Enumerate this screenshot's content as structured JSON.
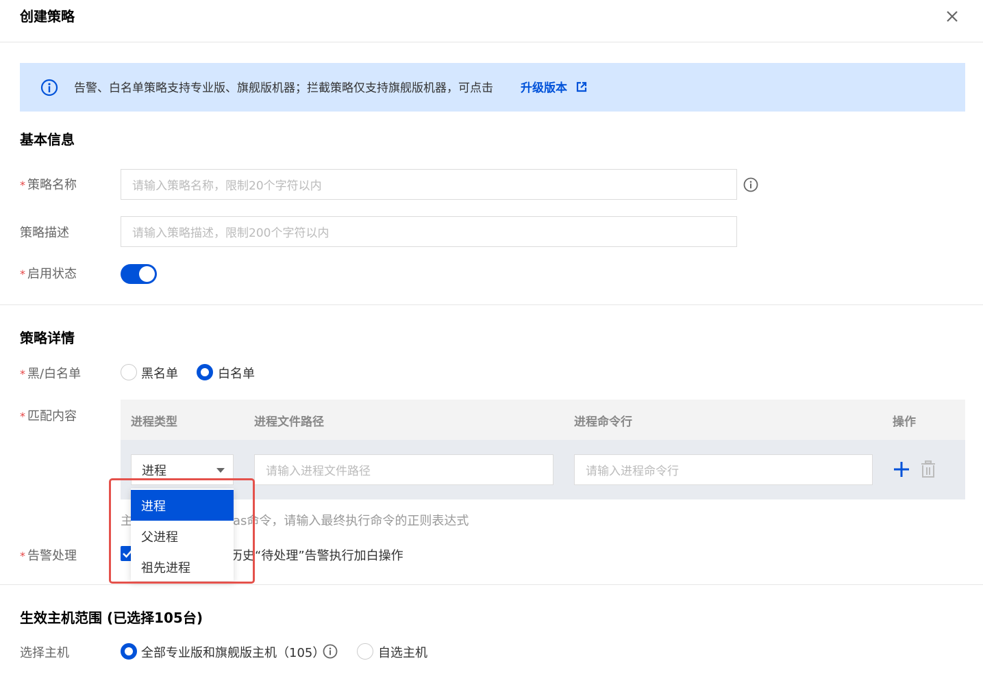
{
  "dialog": {
    "title": "创建策略",
    "close_icon": "close-icon"
  },
  "notice": {
    "text": "告警、白名单策略支持专业版、旗舰版机器；拦截策略仅支持旗舰版机器，可点击",
    "link": "升级版本",
    "icon": "info-circle-icon",
    "background": "#d5e7ff",
    "link_color": "#0052d9"
  },
  "basic": {
    "section_title": "基本信息",
    "name_label": "策略名称",
    "name_placeholder": "请输入策略名称，限制20个字符以内",
    "desc_label": "策略描述",
    "desc_placeholder": "请输入策略描述，限制200个字符以内",
    "status_label": "启用状态",
    "status_on": true
  },
  "detail": {
    "section_title": "策略详情",
    "list_type_label": "黑/白名单",
    "list_options": [
      {
        "label": "黑名单",
        "selected": false
      },
      {
        "label": "白名单",
        "selected": true
      }
    ],
    "match_label": "匹配内容",
    "table_headers": [
      "进程类型",
      "进程文件路径",
      "进程命令行",
      "操作"
    ],
    "row": {
      "process_type": "进程",
      "path_placeholder": "请输入进程文件路径",
      "cmd_placeholder": "请输入进程命令行"
    },
    "hint_left": "主",
    "hint_right": "as命令，请输入最终执行命令的正则表达式",
    "alert_label": "告警处理",
    "alert_checked": true,
    "alert_text": "历史“待处理”告警执行加白操作",
    "dropdown_options": [
      "进程",
      "父进程",
      "祖先进程"
    ],
    "dropdown_selected": "进程"
  },
  "scope": {
    "section_title": "生效主机范围 (已选择105台)",
    "host_label": "选择主机",
    "options": [
      {
        "label": "全部专业版和旗舰版主机（105）",
        "selected": true
      },
      {
        "label": "自选主机",
        "selected": false
      }
    ]
  },
  "colors": {
    "primary": "#0052d9",
    "required": "#e54545",
    "highlight_box": "#e4514b"
  }
}
